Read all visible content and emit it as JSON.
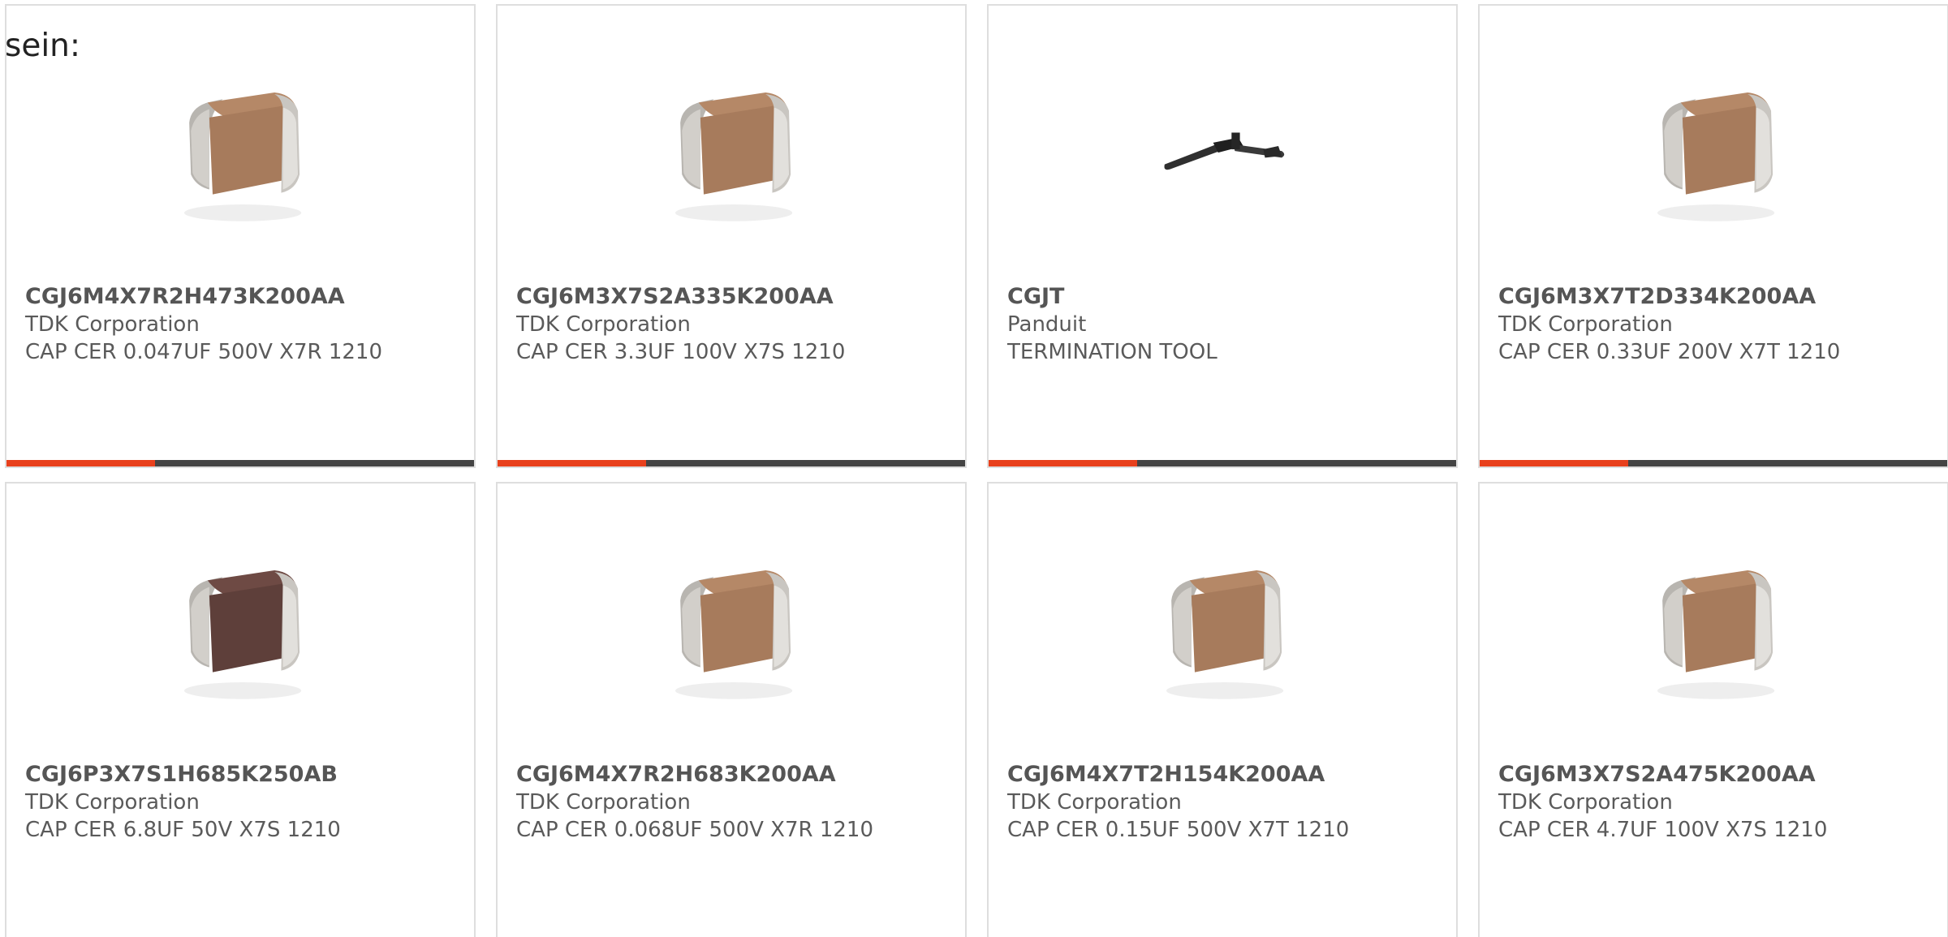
{
  "intro_text": "sein:",
  "colors": {
    "accent": "#e8401c",
    "bar": "#444444",
    "border": "#dedede"
  },
  "products": [
    {
      "part": "CGJ6M4X7R2H473K200AA",
      "maker": "TDK Corporation",
      "desc": "CAP CER 0.047UF 500V X7R 1210",
      "image": "ceramic-capacitor-tan"
    },
    {
      "part": "CGJ6M3X7S2A335K200AA",
      "maker": "TDK Corporation",
      "desc": "CAP CER 3.3UF 100V X7S 1210",
      "image": "ceramic-capacitor-tan"
    },
    {
      "part": "CGJT",
      "maker": "Panduit",
      "desc": "TERMINATION TOOL",
      "image": "termination-tool"
    },
    {
      "part": "CGJ6M3X7T2D334K200AA",
      "maker": "TDK Corporation",
      "desc": "CAP CER 0.33UF 200V X7T 1210",
      "image": "ceramic-capacitor-tan"
    },
    {
      "part": "CGJ6P3X7S1H685K250AB",
      "maker": "TDK Corporation",
      "desc": "CAP CER 6.8UF 50V X7S 1210",
      "image": "ceramic-capacitor-dark"
    },
    {
      "part": "CGJ6M4X7R2H683K200AA",
      "maker": "TDK Corporation",
      "desc": "CAP CER 0.068UF 500V X7R 1210",
      "image": "ceramic-capacitor-tan"
    },
    {
      "part": "CGJ6M4X7T2H154K200AA",
      "maker": "TDK Corporation",
      "desc": "CAP CER 0.15UF 500V X7T 1210",
      "image": "ceramic-capacitor-tan"
    },
    {
      "part": "CGJ6M3X7S2A475K200AA",
      "maker": "TDK Corporation",
      "desc": "CAP CER 4.7UF 100V X7S 1210",
      "image": "ceramic-capacitor-tan"
    }
  ]
}
